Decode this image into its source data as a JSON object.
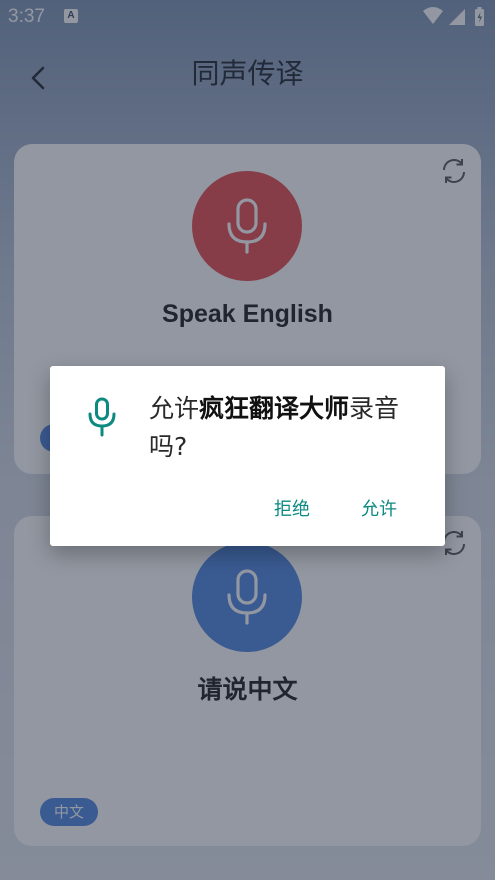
{
  "status_bar": {
    "time": "3:37",
    "notification_icon": "A"
  },
  "header": {
    "title": "同声传译",
    "back_icon": "chevron-left"
  },
  "cards": [
    {
      "prompt": "Speak English",
      "language": "",
      "mic_color": "#e74a4a"
    },
    {
      "prompt": "请说中文",
      "language": "中文",
      "mic_color": "#4f86e0"
    }
  ],
  "dialog": {
    "message_prefix": "允许",
    "app_name": "疯狂翻译大师",
    "message_suffix": "录音吗?",
    "deny_label": "拒绝",
    "allow_label": "允许",
    "accent_color": "#0b8a80"
  }
}
